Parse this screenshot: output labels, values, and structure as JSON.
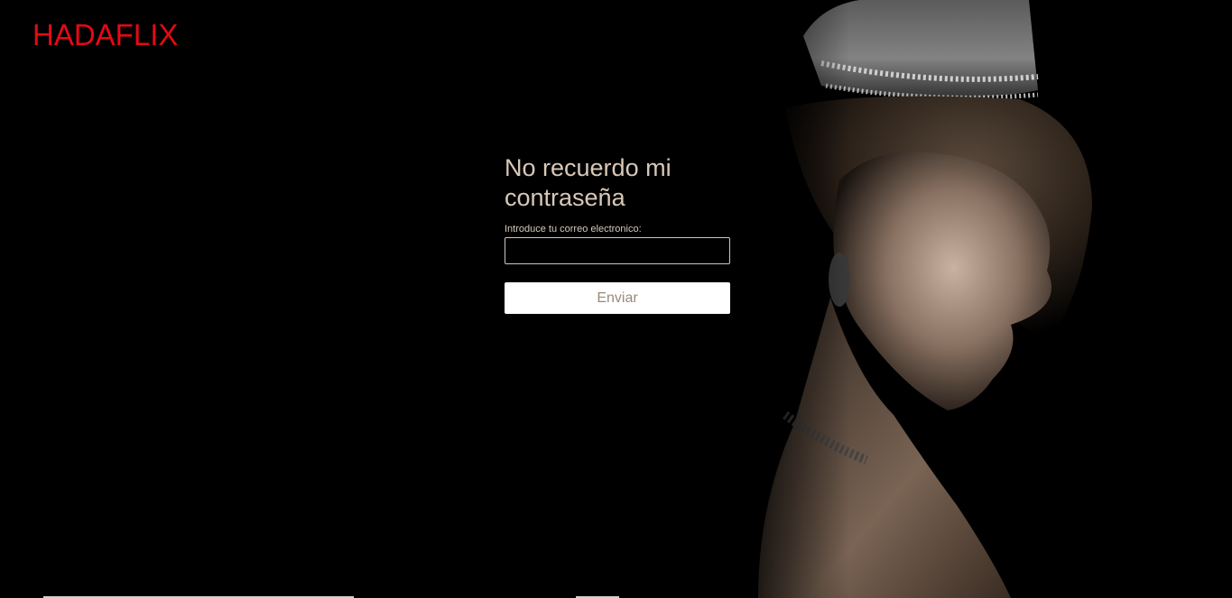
{
  "header": {
    "logo_text": "HADAFLIX"
  },
  "form": {
    "title": "No recuerdo mi contraseña",
    "email_label": "Introduce tu correo electronico:",
    "email_value": "",
    "email_placeholder": "",
    "submit_label": "Enviar"
  },
  "colors": {
    "brand": "#e50914",
    "text": "#d8c8b8",
    "background": "#000000",
    "button_bg": "#ffffff",
    "button_text": "#9a8a7a"
  },
  "icons": {
    "hero": "queen-portrait-image"
  }
}
